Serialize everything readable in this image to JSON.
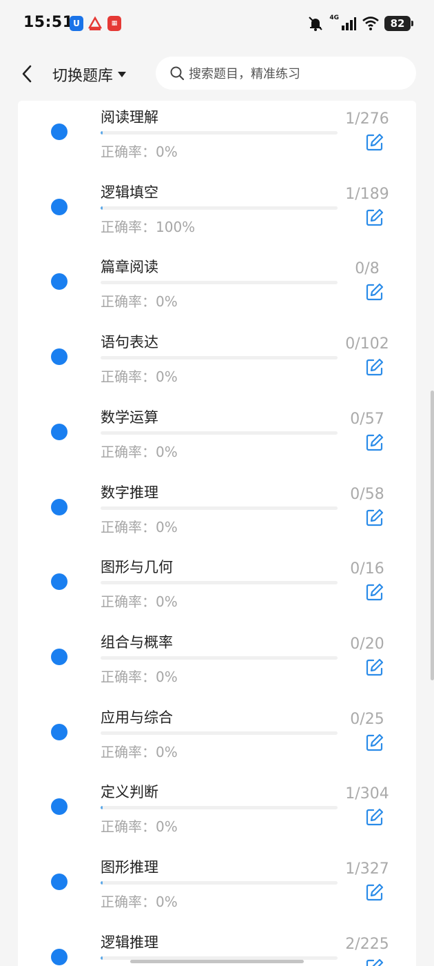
{
  "status_bar": {
    "time": "15:51",
    "network": "4G",
    "battery": "82",
    "icons": [
      "app-u-icon",
      "app-red-triangle-icon",
      "app-red-square-icon",
      "mute-bell-icon",
      "signal-icon",
      "wifi-icon",
      "battery-icon"
    ]
  },
  "header": {
    "title": "切换题库",
    "search_placeholder": "搜索题目，精准练习"
  },
  "accuracy_label": "正确率：",
  "colors": {
    "dot": "#1a7ff0",
    "progress_fill": "#5aa7e8",
    "edit_icon": "#2a8be8",
    "count_text": "#aaaaaa"
  },
  "categories": [
    {
      "name": "阅读理解",
      "accuracy": "0%",
      "count": "1/276",
      "progress": 0.0036
    },
    {
      "name": "逻辑填空",
      "accuracy": "100%",
      "count": "1/189",
      "progress": 0.0053
    },
    {
      "name": "篇章阅读",
      "accuracy": "0%",
      "count": "0/8",
      "progress": 0
    },
    {
      "name": "语句表达",
      "accuracy": "0%",
      "count": "0/102",
      "progress": 0
    },
    {
      "name": "数学运算",
      "accuracy": "0%",
      "count": "0/57",
      "progress": 0
    },
    {
      "name": "数字推理",
      "accuracy": "0%",
      "count": "0/58",
      "progress": 0
    },
    {
      "name": "图形与几何",
      "accuracy": "0%",
      "count": "0/16",
      "progress": 0
    },
    {
      "name": "组合与概率",
      "accuracy": "0%",
      "count": "0/20",
      "progress": 0
    },
    {
      "name": "应用与综合",
      "accuracy": "0%",
      "count": "0/25",
      "progress": 0
    },
    {
      "name": "定义判断",
      "accuracy": "0%",
      "count": "1/304",
      "progress": 0.0033
    },
    {
      "name": "图形推理",
      "accuracy": "0%",
      "count": "1/327",
      "progress": 0.0031
    },
    {
      "name": "逻辑推理",
      "accuracy": "",
      "count": "2/225",
      "progress": 0.0089
    }
  ]
}
